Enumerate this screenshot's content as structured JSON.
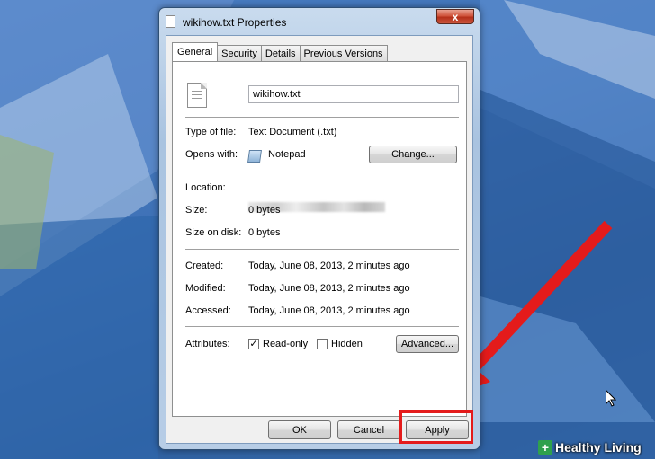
{
  "window": {
    "title": "wikihow.txt Properties",
    "close_symbol": "x"
  },
  "tabs": [
    {
      "label": "General",
      "active": true
    },
    {
      "label": "Security",
      "active": false
    },
    {
      "label": "Details",
      "active": false
    },
    {
      "label": "Previous Versions",
      "active": false
    }
  ],
  "general": {
    "file_name": "wikihow.txt",
    "type_of_file_label": "Type of file:",
    "type_of_file_value": "Text Document (.txt)",
    "opens_with_label": "Opens with:",
    "opens_with_value": "Notepad",
    "change_button": "Change...",
    "location_label": "Location:",
    "size_label": "Size:",
    "size_value": "0 bytes",
    "size_on_disk_label": "Size on disk:",
    "size_on_disk_value": "0 bytes",
    "created_label": "Created:",
    "created_value": "Today, June 08, 2013, 2 minutes ago",
    "modified_label": "Modified:",
    "modified_value": "Today, June 08, 2013, 2 minutes ago",
    "accessed_label": "Accessed:",
    "accessed_value": "Today, June 08, 2013, 2 minutes ago",
    "attributes_label": "Attributes:",
    "readonly_label": "Read-only",
    "readonly_checked": true,
    "hidden_label": "Hidden",
    "hidden_checked": false,
    "advanced_button": "Advanced..."
  },
  "footer": {
    "ok": "OK",
    "cancel": "Cancel",
    "apply": "Apply"
  },
  "watermark": {
    "text": "Healthy Living",
    "symbol": "+"
  },
  "annotation": {
    "arrow_color": "#e41b1b",
    "highlight_color": "#e41b1b"
  }
}
